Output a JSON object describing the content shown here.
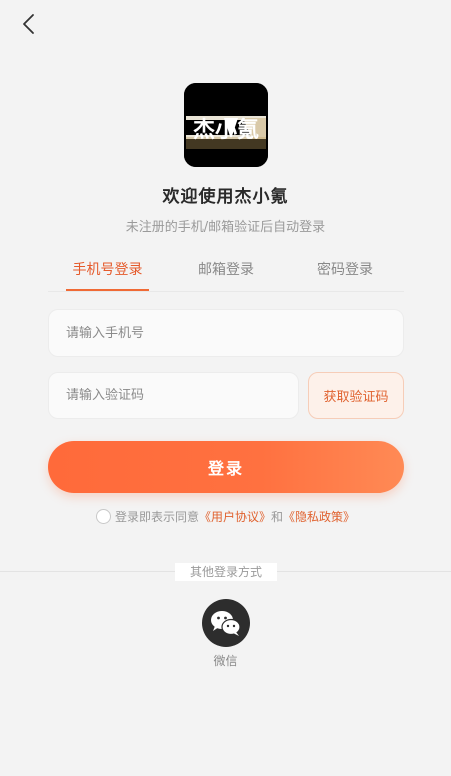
{
  "header": {
    "back_icon": "chevron-left-icon"
  },
  "logo": {
    "text": "杰小氪",
    "background": "#000000"
  },
  "welcome_title": "欢迎使用杰小氪",
  "subtitle": "未注册的手机/邮箱验证后自动登录",
  "tabs": [
    {
      "label": "手机号登录",
      "active": true
    },
    {
      "label": "邮箱登录",
      "active": false
    },
    {
      "label": "密码登录",
      "active": false
    }
  ],
  "phone_input": {
    "placeholder": "请输入手机号",
    "value": ""
  },
  "code_input": {
    "placeholder": "请输入验证码",
    "value": ""
  },
  "get_code_label": "获取验证码",
  "login_label": "登录",
  "agreement": {
    "prefix": "登录即表示同意",
    "user_agreement": "《用户协议》",
    "and": "和",
    "privacy_policy": "《隐私政策》",
    "checked": false
  },
  "other_login": {
    "label": "其他登录方式",
    "options": [
      {
        "label": "微信",
        "icon": "wechat-icon"
      }
    ]
  },
  "colors": {
    "accent": "#f06a35",
    "background": "#f3f3f3"
  }
}
